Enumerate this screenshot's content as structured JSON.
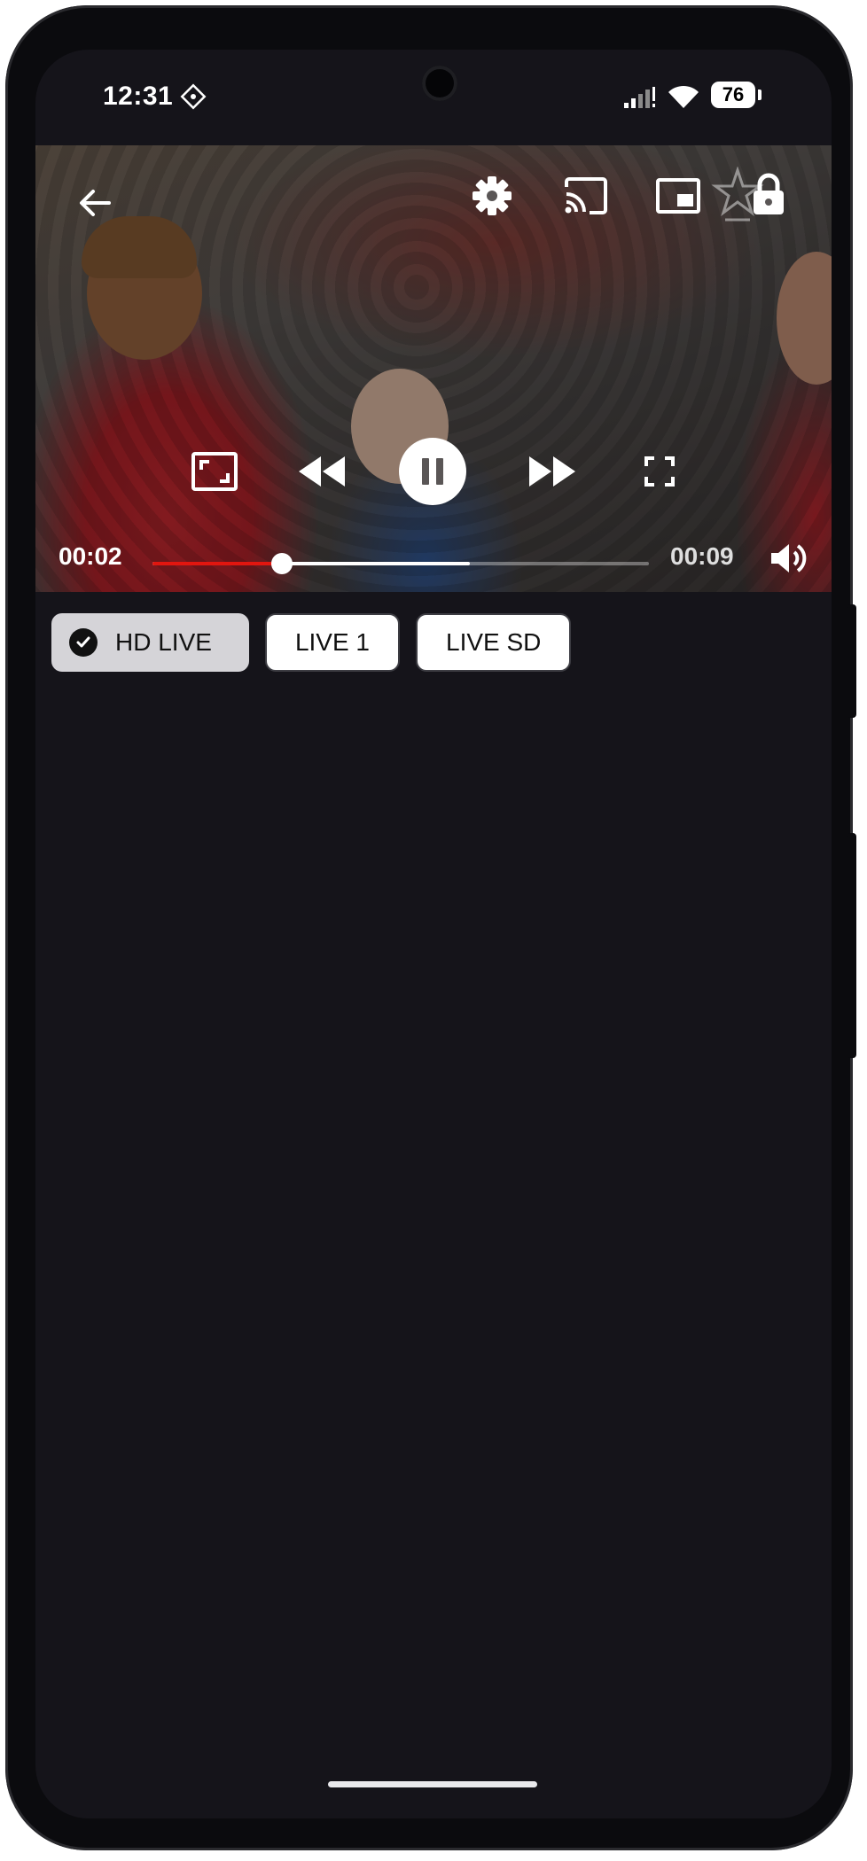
{
  "status_bar": {
    "time": "12:31",
    "battery": "76",
    "icons": [
      "app-notification-icon",
      "signal-icon",
      "wifi-icon",
      "battery-icon"
    ]
  },
  "player": {
    "current_time": "00:02",
    "duration": "00:09",
    "progress_fraction": 0.26,
    "buffered_fraction": 0.64,
    "top_controls": [
      "back-arrow-icon",
      "settings-gear-icon",
      "cast-icon",
      "picture-in-picture-icon",
      "lock-icon"
    ],
    "center_controls": [
      "resize-icon",
      "rewind-icon",
      "pause-icon",
      "fast-forward-icon",
      "fullscreen-icon"
    ],
    "accent_color": "#e1160f"
  },
  "streams": {
    "items": [
      {
        "label": "HD LIVE",
        "selected": true
      },
      {
        "label": "LIVE 1",
        "selected": false
      },
      {
        "label": "LIVE SD",
        "selected": false
      }
    ]
  },
  "colors": {
    "background": "#15141a",
    "chip_selected": "#d5d4d8",
    "chip": "#ffffff"
  }
}
